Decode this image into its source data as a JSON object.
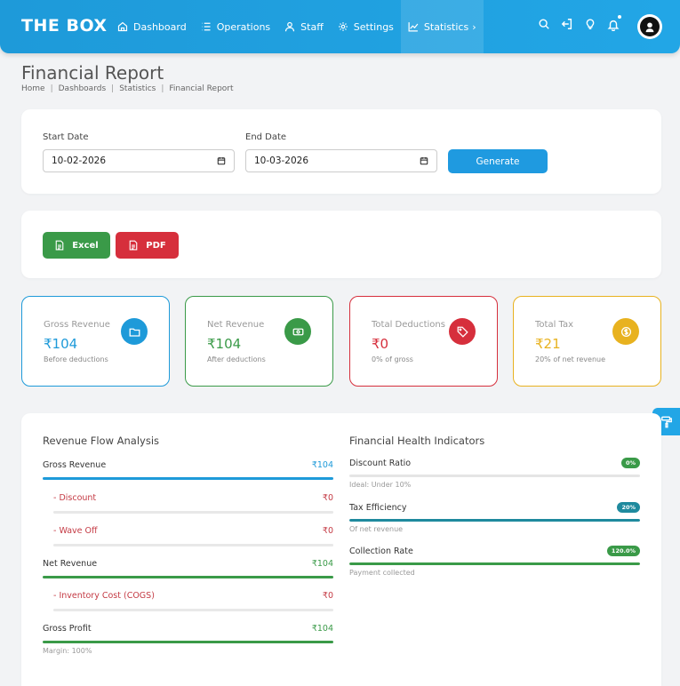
{
  "header": {
    "brand": "THE BOX",
    "nav": [
      {
        "label": "Dashboard",
        "icon": "home-icon"
      },
      {
        "label": "Operations",
        "icon": "list-icon"
      },
      {
        "label": "Staff",
        "icon": "user-icon"
      },
      {
        "label": "Settings",
        "icon": "gear-icon"
      },
      {
        "label": "Statistics",
        "icon": "chart-line-icon",
        "active": true,
        "chevron": "›"
      }
    ],
    "icons": [
      "search-icon",
      "logout-icon",
      "bulb-icon",
      "bell-icon",
      "avatar"
    ]
  },
  "page": {
    "title": "Financial Report",
    "breadcrumb": [
      "Home",
      "Dashboards",
      "Statistics",
      "Financial Report"
    ],
    "separator": "|"
  },
  "filters": {
    "start_label": "Start Date",
    "start_value": "10-02-2026",
    "end_label": "End Date",
    "end_value": "10-03-2026",
    "generate_label": "Generate"
  },
  "export": {
    "excel_label": "Excel",
    "pdf_label": "PDF"
  },
  "stats": [
    {
      "label": "Gross Revenue",
      "value": "₹104",
      "sub": "Before deductions",
      "color": "#1e9ad9",
      "icon": "folder-icon"
    },
    {
      "label": "Net Revenue",
      "value": "₹104",
      "sub": "After deductions",
      "color": "#3a9a48",
      "icon": "money-icon"
    },
    {
      "label": "Total Deductions",
      "value": "₹0",
      "sub": "0% of gross",
      "color": "#d62f3c",
      "icon": "tag-icon"
    },
    {
      "label": "Total Tax",
      "value": "₹21",
      "sub": "20% of net revenue",
      "color": "#e8b21f",
      "icon": "dollar-icon"
    }
  ],
  "flow": {
    "title": "Revenue Flow Analysis",
    "rows": [
      {
        "label": "Gross Revenue",
        "value": "₹104"
      },
      {
        "label": "- Discount",
        "value": "₹0"
      },
      {
        "label": "- Wave Off",
        "value": "₹0"
      },
      {
        "label": "Net Revenue",
        "value": "₹104"
      },
      {
        "label": "- Inventory Cost (COGS)",
        "value": "₹0"
      },
      {
        "label": "Gross Profit",
        "value": "₹104"
      }
    ],
    "margin": "Margin: 100%"
  },
  "health": {
    "title": "Financial Health Indicators",
    "items": [
      {
        "label": "Discount Ratio",
        "badge": "0%",
        "sub": "Ideal: Under 10%",
        "level": 0,
        "color": "#3a9a48"
      },
      {
        "label": "Tax Efficiency",
        "badge": "20%",
        "sub": "Of net revenue",
        "level": 1,
        "color": "#1f8a9e"
      },
      {
        "label": "Collection Rate",
        "badge": "120.0%",
        "sub": "Payment collected",
        "level": 1,
        "color": "#3a9a48"
      }
    ]
  },
  "colors": {
    "primary": "#1e9ad9",
    "green": "#3a9a48",
    "red": "#d62f3c",
    "yellow": "#e8b21f",
    "teal": "#1f8a9e"
  }
}
